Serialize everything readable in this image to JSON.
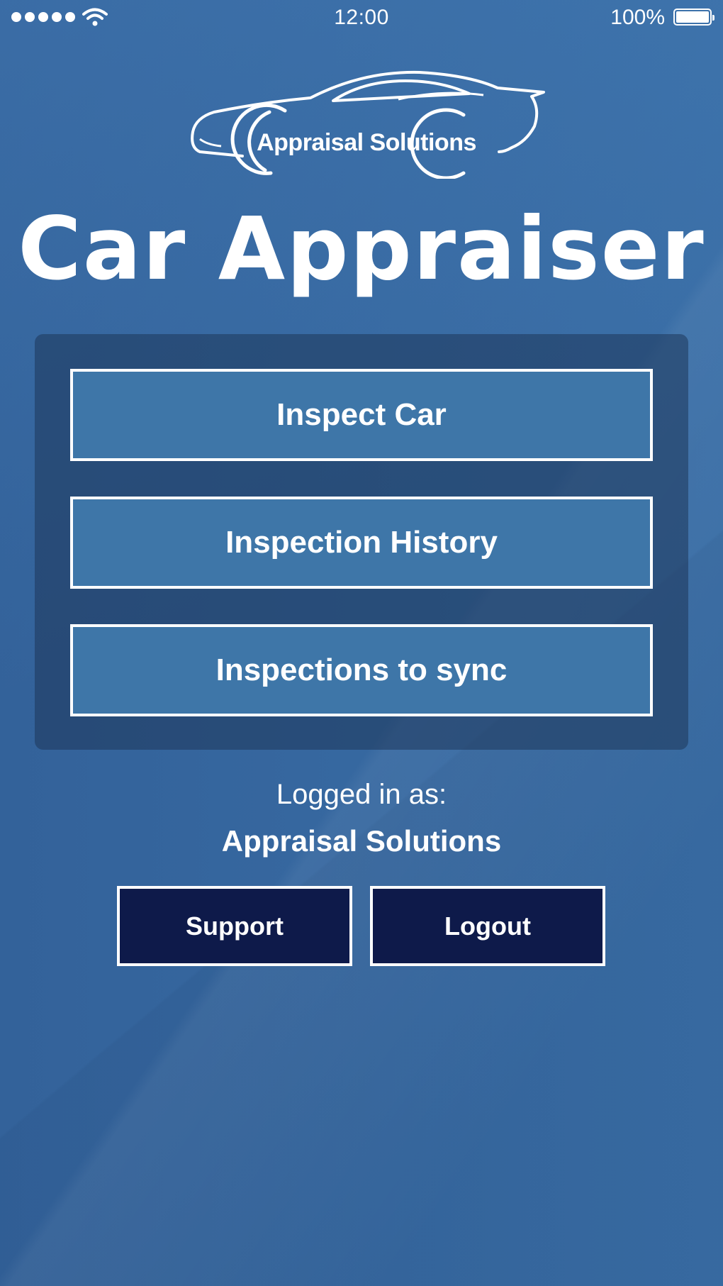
{
  "status_bar": {
    "time": "12:00",
    "battery_percent": "100%",
    "signal_bars": 5,
    "battery_level": 1.0,
    "icons": [
      "signal-dots-icon",
      "wifi-icon",
      "battery-icon"
    ]
  },
  "logo": {
    "text": "Appraisal Solutions",
    "icon": "car-outline-icon"
  },
  "app": {
    "title": "Car Appraiser"
  },
  "menu": {
    "items": [
      {
        "label": "Inspect Car"
      },
      {
        "label": "Inspection History"
      },
      {
        "label": "Inspections to sync"
      }
    ]
  },
  "session": {
    "logged_in_label": "Logged in as:",
    "user_name": "Appraisal Solutions"
  },
  "actions": {
    "support_label": "Support",
    "logout_label": "Logout"
  },
  "colors": {
    "background": "#34659a",
    "menu_button": "#3e76a8",
    "panel": "#1e375a",
    "action_button": "#0e1a4a",
    "foreground": "#ffffff"
  }
}
